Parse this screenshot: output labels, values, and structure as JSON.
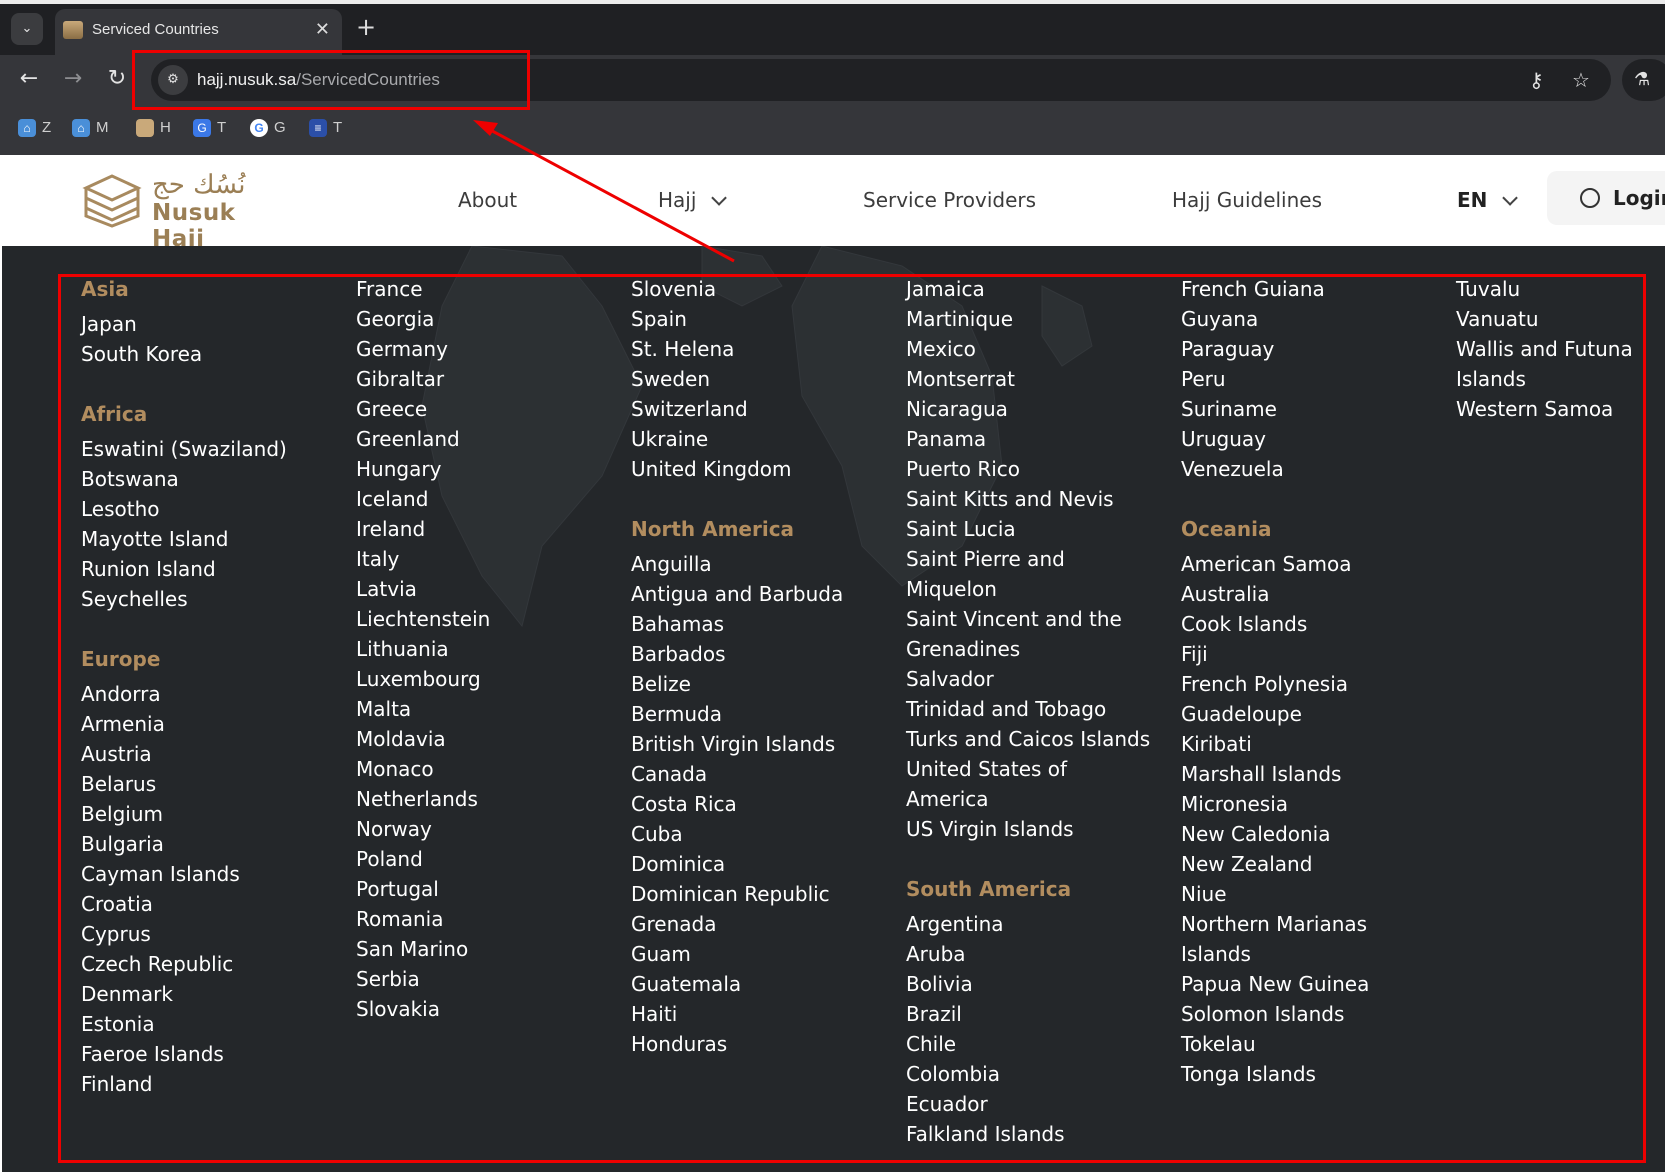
{
  "browser": {
    "tab": {
      "title": "Serviced Countries"
    },
    "url": {
      "host": "hajj.nusuk.sa",
      "path": "/ServicedCountries"
    },
    "bookmarks": [
      "Z",
      "M",
      "H",
      "T",
      "G",
      "T"
    ]
  },
  "site": {
    "logo": {
      "arabic": "نُسُك حج",
      "english": "Nusuk Hajj"
    },
    "nav": {
      "about": "About",
      "hajj": "Hajj",
      "service_providers": "Service Providers",
      "guidelines": "Hajj Guidelines",
      "language": "EN",
      "login": "Login"
    }
  },
  "columns": [
    [
      {
        "region": "Asia",
        "countries": [
          "Japan",
          "South Korea"
        ]
      },
      {
        "region": "Africa",
        "countries": [
          "Eswatini (Swaziland)",
          "Botswana",
          "Lesotho",
          "Mayotte Island",
          "Runion Island",
          "Seychelles"
        ]
      },
      {
        "region": "Europe",
        "countries": [
          "Andorra",
          "Armenia",
          "Austria",
          "Belarus",
          "Belgium",
          "Bulgaria",
          "Cayman Islands",
          "Croatia",
          "Cyprus",
          "Czech Republic",
          "Denmark",
          "Estonia",
          "Faeroe Islands",
          "Finland"
        ]
      }
    ],
    [
      {
        "region": "",
        "countries": [
          "France",
          "Georgia",
          "Germany",
          "Gibraltar",
          "Greece",
          "Greenland",
          "Hungary",
          "Iceland",
          "Ireland",
          "Italy",
          "Latvia",
          "Liechtenstein",
          "Lithuania",
          "Luxembourg",
          "Malta",
          "Moldavia",
          "Monaco",
          "Netherlands",
          "Norway",
          "Poland",
          "Portugal",
          "Romania",
          "San Marino",
          "Serbia",
          "Slovakia"
        ]
      }
    ],
    [
      {
        "region": "",
        "countries": [
          "Slovenia",
          "Spain",
          "St. Helena",
          "Sweden",
          "Switzerland",
          "Ukraine",
          "United Kingdom"
        ]
      },
      {
        "region": "North America",
        "countries": [
          "Anguilla",
          "Antigua and Barbuda",
          "Bahamas",
          "Barbados",
          "Belize",
          "Bermuda",
          "British Virgin Islands",
          "Canada",
          "Costa Rica",
          "Cuba",
          "Dominica",
          "Dominican Republic",
          "Grenada",
          "Guam",
          "Guatemala",
          "Haiti",
          "Honduras"
        ]
      }
    ],
    [
      {
        "region": "",
        "countries": [
          "Jamaica",
          "Martinique",
          "Mexico",
          "Montserrat",
          "Nicaragua",
          "Panama",
          "Puerto Rico",
          "Saint Kitts and Nevis",
          "Saint Lucia",
          "Saint Pierre and",
          "Miquelon",
          "Saint Vincent and the",
          "Grenadines",
          "Salvador",
          "Trinidad and Tobago",
          "Turks and Caicos Islands",
          "United States of",
          "America",
          "US Virgin Islands"
        ]
      },
      {
        "region": "South America",
        "countries": [
          "Argentina",
          "Aruba",
          "Bolivia",
          "Brazil",
          "Chile",
          "Colombia",
          "Ecuador",
          "Falkland Islands"
        ]
      }
    ],
    [
      {
        "region": "",
        "countries": [
          "French Guiana",
          "Guyana",
          "Paraguay",
          "Peru",
          "Suriname",
          "Uruguay",
          "Venezuela"
        ]
      },
      {
        "region": "Oceania",
        "countries": [
          "American Samoa",
          "Australia",
          "Cook Islands",
          "Fiji",
          "French Polynesia",
          "Guadeloupe",
          "Kiribati",
          "Marshall Islands",
          "Micronesia",
          "New Caledonia",
          "New Zealand",
          "Niue",
          "Northern Marianas",
          "Islands",
          "Papua New Guinea",
          "Solomon Islands",
          "Tokelau",
          "Tonga Islands"
        ]
      }
    ],
    [
      {
        "region": "",
        "countries": [
          "Tuvalu",
          "Vanuatu",
          "Wallis and Futuna",
          "Islands",
          "Western Samoa"
        ]
      }
    ]
  ],
  "colors": {
    "background": "#24272a",
    "region_heading": "#b28d5f",
    "country_text": "#ffffff",
    "annotation": "#ee0000",
    "brand_gold": "#9b7f55"
  }
}
